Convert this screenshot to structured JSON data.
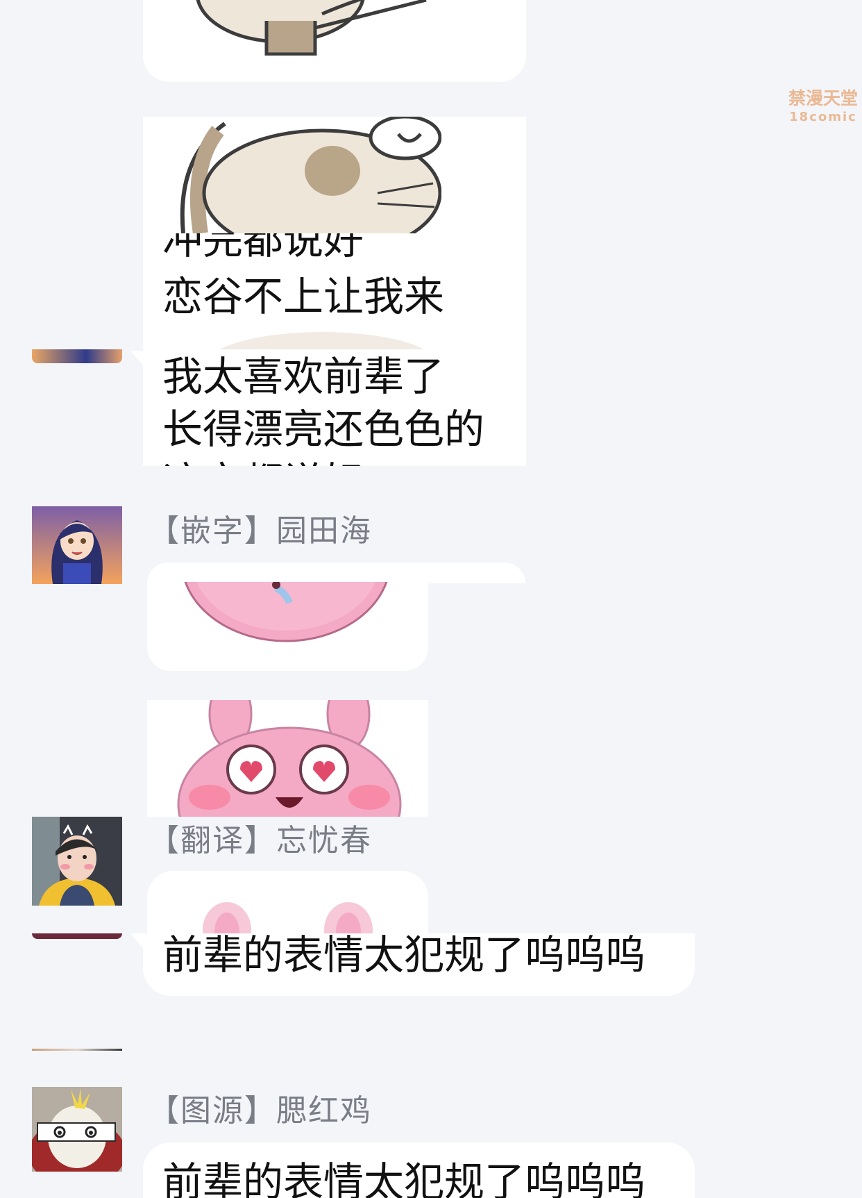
{
  "watermark": {
    "line1": "禁漫天堂",
    "line2": "18comic"
  },
  "messages": {
    "cropped_top": {
      "line": "冲完都说好"
    },
    "overlay_block": {
      "line1": "恋谷不上让我来",
      "line2": "我太喜欢前辈了",
      "line3": "长得漂亮还色色的",
      "line4": "这完都说好"
    },
    "sender1": {
      "name": "【嵌字】园田海"
    },
    "sender2": {
      "name": "【翻译】忘忧春"
    },
    "msg2": {
      "text": "前辈的表情太犯规了呜呜呜"
    },
    "sender3": {
      "name": "【图源】腮红鸡"
    },
    "msg3": {
      "text": "前辈的表情太犯规了呜呜呜"
    }
  },
  "colors": {
    "background": "#f3f5f9",
    "bubble": "#ffffff",
    "sender_text": "#7a7d86",
    "message_text": "#111111",
    "sticker_pink": "#f4a9c4"
  },
  "icons": [
    "cat-sticker",
    "pink-bunny-sticker",
    "avatar-anime-girl",
    "avatar-young-man",
    "avatar-bird-figure"
  ]
}
